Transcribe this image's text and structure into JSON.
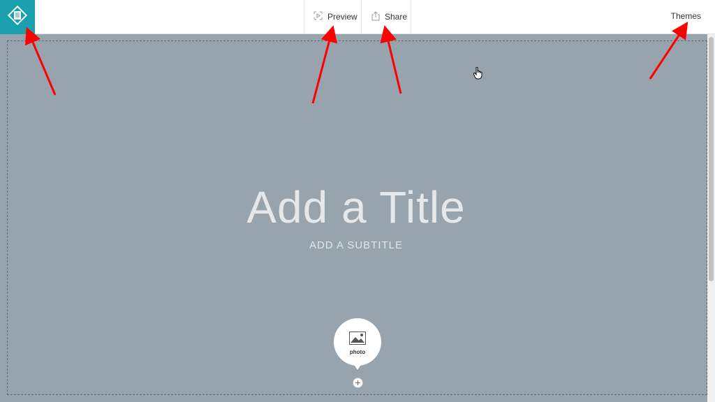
{
  "topbar": {
    "preview_label": "Preview",
    "share_label": "Share",
    "themes_label": "Themes",
    "logo_icon": "document-diamond-icon"
  },
  "canvas": {
    "title_placeholder": "Add a Title",
    "subtitle_placeholder": "ADD A SUBTITLE"
  },
  "media_picker": {
    "photo_label": "photo",
    "add_icon": "plus-circle-icon"
  },
  "colors": {
    "logo_bg": "#1aa0ae",
    "canvas_bg": "#97a4ad",
    "annotation_arrow": "#ff0000"
  }
}
